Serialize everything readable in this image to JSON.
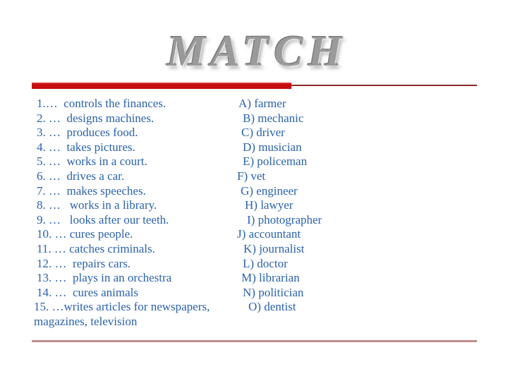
{
  "slide": {
    "title": "MATCH",
    "background_color": "#ffffff",
    "text_color": "#2a62ab",
    "accent_bar_color": "#cc1010",
    "rule_color": "#8a2a22",
    "bottom_rule_color": "#bd8d8d",
    "title_color": "#9a9a9a"
  },
  "exercise": {
    "definitions": [
      "1.…  controls the finances.",
      "2. …  designs machines.",
      "3. …  produces food.",
      "4. …  takes pictures.",
      "5. …  works in a court.",
      "6. …  drives a car.",
      "7. …  makes speeches.",
      "8. …   works in a library.",
      "9. …   looks after our teeth.",
      "10. … cures people.",
      "11. … catches criminals.",
      "12. …  repairs cars.",
      "13. …  plays in an orchestra",
      "14. …  cures animals",
      "15. …writes articles for newspapers,"
    ],
    "definitions_continuation": "magazines, television",
    "options": [
      "A) farmer",
      "B) mechanic",
      "C) driver",
      "D) musician",
      "E) policeman",
      "F) vet",
      "G) engineer",
      "H) lawyer",
      "I) photographer",
      "J) accountant",
      "K) journalist",
      "L) doctor",
      "M) librarian",
      "N) politician",
      "O) dentist"
    ]
  }
}
